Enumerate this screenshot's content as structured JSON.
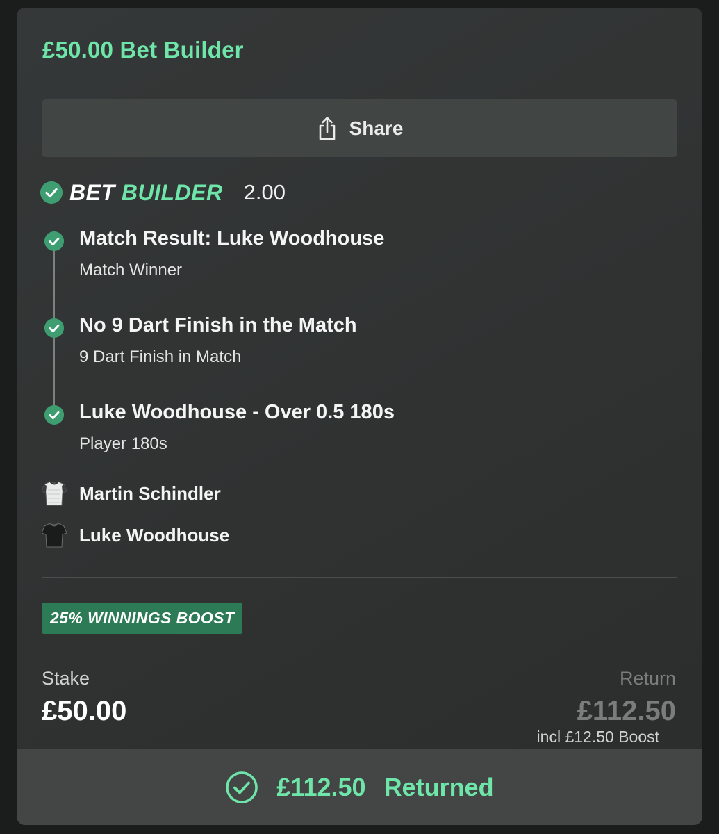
{
  "header": {
    "title": "£50.00 Bet Builder"
  },
  "share": {
    "label": "Share",
    "icon": "share-icon"
  },
  "bet_builder": {
    "logo_part1": "BET",
    "logo_part2": "BUILDER",
    "odds": "2.00",
    "status": "won"
  },
  "legs": [
    {
      "title": "Match Result: Luke Woodhouse",
      "subtitle": "Match Winner",
      "status": "won"
    },
    {
      "title": "No 9 Dart Finish in the Match",
      "subtitle": "9 Dart Finish in Match",
      "status": "won"
    },
    {
      "title": "Luke Woodhouse - Over 0.5 180s",
      "subtitle": "Player 180s",
      "status": "won"
    }
  ],
  "players": [
    {
      "name": "Martin Schindler",
      "icon": "white-shirt-icon"
    },
    {
      "name": "Luke Woodhouse",
      "icon": "black-shirt-icon"
    }
  ],
  "boost": {
    "label": "25% WINNINGS BOOST"
  },
  "stake": {
    "label": "Stake",
    "value": "£50.00"
  },
  "return": {
    "label": "Return",
    "value": "£112.50",
    "note": "incl £12.50 Boost"
  },
  "footer": {
    "amount": "£112.50",
    "status_text": "Returned",
    "icon": "check-circle-icon"
  },
  "colors": {
    "accent_green": "#6fe6a9",
    "check_green": "#3e9e71",
    "badge_green": "#2d7a56",
    "card_bg": "#323535",
    "footer_bg": "#444545",
    "muted_text": "#7a7d7c"
  }
}
